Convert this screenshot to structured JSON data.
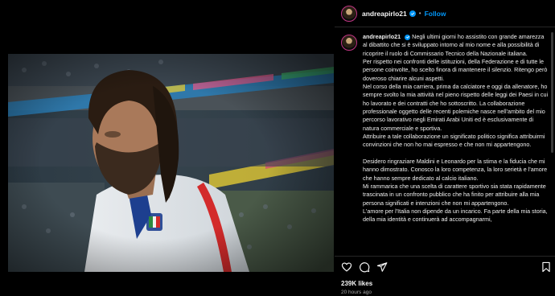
{
  "post": {
    "username": "andreapirlo21",
    "follow_label": "Follow",
    "separator": "•",
    "caption_paragraphs": [
      "Negli ultimi giorni ho assistito con grande amarezza al dibattito che si è sviluppato intorno al mio nome e alla possibilità di ricoprire il ruolo di Commissario Tecnico della Nazionale italiana.",
      "Per rispetto nei confronti delle istituzioni, della Federazione e di tutte le persone coinvolte, ho scelto finora di mantenere il silenzio. Ritengo però doveroso chiarire alcuni aspetti.",
      "Nel corso della mia carriera, prima da calciatore e oggi da allenatore, ho sempre svolto la mia attività nel pieno rispetto delle leggi dei Paesi in cui ho lavorato e dei contratti che ho sottoscritto. La collaborazione professionale oggetto delle recenti polemiche nasce nell'ambito del mio percorso lavorativo negli Emirati Arabi Uniti ed è esclusivamente di natura commerciale e sportiva.",
      "Attribuire a tale collaborazione un significato politico significa attribuirmi convinzioni che non ho mai espresso e che non mi appartengono.",
      "",
      "Desidero ringraziare Maldini e Leonardo per la stima e la fiducia che mi hanno dimostrato. Conosco la loro competenza, la loro serietà e l'amore che hanno sempre dedicato al calcio italiano.",
      "Mi rammarica che una scelta di carattere sportivo sia stata rapidamente trascinata in un confronto pubblico che ha finito per attribuire alla mia persona significati e intenzioni che non mi appartengono.",
      "L'amore per l'Italia non dipende da un incarico. Fa parte della mia storia, della mia identità e continuerà ad accompagnarmi,"
    ],
    "likes": "239K likes",
    "time_ago": "20 hours ago"
  },
  "icons": {
    "like": "heart-icon",
    "comment": "comment-icon",
    "share": "send-icon",
    "save": "bookmark-icon",
    "verified": "verified-badge-icon"
  },
  "colors": {
    "accent_blue": "#0095f6",
    "background": "#000000",
    "secondary_text": "#a8a8a8"
  }
}
